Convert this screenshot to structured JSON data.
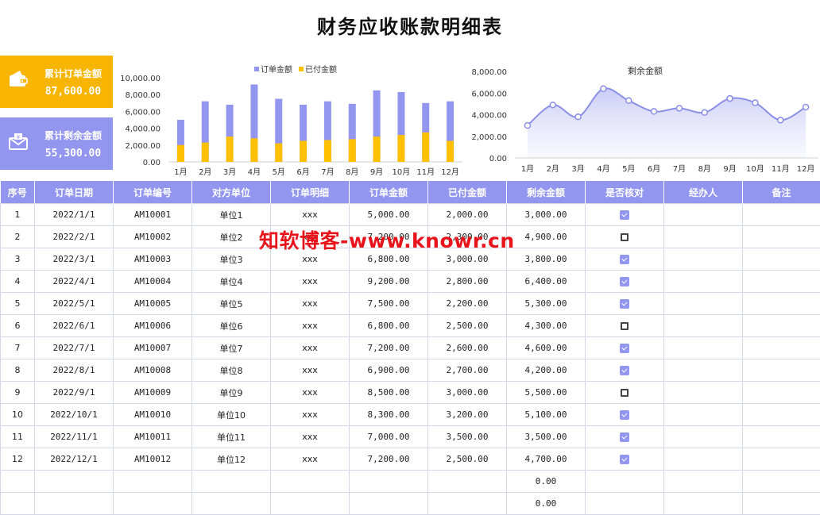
{
  "title": "财务应收账款明细表",
  "cards": [
    {
      "label": "累计订单金额",
      "value": "87,600.00",
      "icon": "wallet-icon"
    },
    {
      "label": "累计剩余金额",
      "value": "55,300.00",
      "icon": "envelope-money-icon"
    }
  ],
  "colors": {
    "accent": "#9396ee",
    "gold": "#f7b500",
    "paid": "#ffc000",
    "line": "#8a8fe8"
  },
  "watermark": "知软博客-www.knowr.cn",
  "chart_data": [
    {
      "type": "bar",
      "categories": [
        "1月",
        "2月",
        "3月",
        "4月",
        "5月",
        "6月",
        "7月",
        "8月",
        "9月",
        "10月",
        "11月",
        "12月"
      ],
      "series": [
        {
          "name": "订单金额",
          "values": [
            5000,
            7200,
            6800,
            9200,
            7500,
            6800,
            7200,
            6900,
            8500,
            8300,
            7000,
            7200
          ]
        },
        {
          "name": "已付金额",
          "values": [
            2000,
            2300,
            3000,
            2800,
            2200,
            2500,
            2600,
            2700,
            3000,
            3200,
            3500,
            2500
          ]
        }
      ],
      "yticks": [
        "0.00",
        "2,000.00",
        "4,000.00",
        "6,000.00",
        "8,000.00",
        "10,000.00"
      ],
      "ylim": [
        0,
        10000
      ],
      "legend": "top"
    },
    {
      "type": "area",
      "title": "剩余金额",
      "categories": [
        "1月",
        "2月",
        "3月",
        "4月",
        "5月",
        "6月",
        "7月",
        "8月",
        "9月",
        "10月",
        "11月",
        "12月"
      ],
      "values": [
        3000,
        4900,
        3800,
        6400,
        5300,
        4300,
        4600,
        4200,
        5500,
        5100,
        3500,
        4700
      ],
      "yticks": [
        "0.00",
        "2,000.00",
        "4,000.00",
        "6,000.00",
        "8,000.00"
      ],
      "ylim": [
        0,
        8000
      ]
    }
  ],
  "table": {
    "headers": [
      "序号",
      "订单日期",
      "订单编号",
      "对方单位",
      "订单明细",
      "订单金额",
      "已付金额",
      "剩余金额",
      "是否核对",
      "经办人",
      "备注"
    ],
    "rows": [
      {
        "no": "1",
        "date": "2022/1/1",
        "id": "AM10001",
        "unit": "单位1",
        "detail": "xxx",
        "amount": "5,000.00",
        "paid": "2,000.00",
        "remain": "3,000.00",
        "checked": true
      },
      {
        "no": "2",
        "date": "2022/2/1",
        "id": "AM10002",
        "unit": "单位2",
        "detail": "xxx",
        "amount": "7,200.00",
        "paid": "2,300.00",
        "remain": "4,900.00",
        "checked": false
      },
      {
        "no": "3",
        "date": "2022/3/1",
        "id": "AM10003",
        "unit": "单位3",
        "detail": "xxx",
        "amount": "6,800.00",
        "paid": "3,000.00",
        "remain": "3,800.00",
        "checked": true
      },
      {
        "no": "4",
        "date": "2022/4/1",
        "id": "AM10004",
        "unit": "单位4",
        "detail": "xxx",
        "amount": "9,200.00",
        "paid": "2,800.00",
        "remain": "6,400.00",
        "checked": true
      },
      {
        "no": "5",
        "date": "2022/5/1",
        "id": "AM10005",
        "unit": "单位5",
        "detail": "xxx",
        "amount": "7,500.00",
        "paid": "2,200.00",
        "remain": "5,300.00",
        "checked": true
      },
      {
        "no": "6",
        "date": "2022/6/1",
        "id": "AM10006",
        "unit": "单位6",
        "detail": "xxx",
        "amount": "6,800.00",
        "paid": "2,500.00",
        "remain": "4,300.00",
        "checked": false
      },
      {
        "no": "7",
        "date": "2022/7/1",
        "id": "AM10007",
        "unit": "单位7",
        "detail": "xxx",
        "amount": "7,200.00",
        "paid": "2,600.00",
        "remain": "4,600.00",
        "checked": true
      },
      {
        "no": "8",
        "date": "2022/8/1",
        "id": "AM10008",
        "unit": "单位8",
        "detail": "xxx",
        "amount": "6,900.00",
        "paid": "2,700.00",
        "remain": "4,200.00",
        "checked": true
      },
      {
        "no": "9",
        "date": "2022/9/1",
        "id": "AM10009",
        "unit": "单位9",
        "detail": "xxx",
        "amount": "8,500.00",
        "paid": "3,000.00",
        "remain": "5,500.00",
        "checked": false
      },
      {
        "no": "10",
        "date": "2022/10/1",
        "id": "AM10010",
        "unit": "单位10",
        "detail": "xxx",
        "amount": "8,300.00",
        "paid": "3,200.00",
        "remain": "5,100.00",
        "checked": true
      },
      {
        "no": "11",
        "date": "2022/11/1",
        "id": "AM10011",
        "unit": "单位11",
        "detail": "xxx",
        "amount": "7,000.00",
        "paid": "3,500.00",
        "remain": "3,500.00",
        "checked": true
      },
      {
        "no": "12",
        "date": "2022/12/1",
        "id": "AM10012",
        "unit": "单位12",
        "detail": "xxx",
        "amount": "7,200.00",
        "paid": "2,500.00",
        "remain": "4,700.00",
        "checked": true
      },
      {
        "no": "",
        "date": "",
        "id": "",
        "unit": "",
        "detail": "",
        "amount": "",
        "paid": "",
        "remain": "0.00",
        "checked": null
      },
      {
        "no": "",
        "date": "",
        "id": "",
        "unit": "",
        "detail": "",
        "amount": "",
        "paid": "",
        "remain": "0.00",
        "checked": null
      }
    ]
  }
}
